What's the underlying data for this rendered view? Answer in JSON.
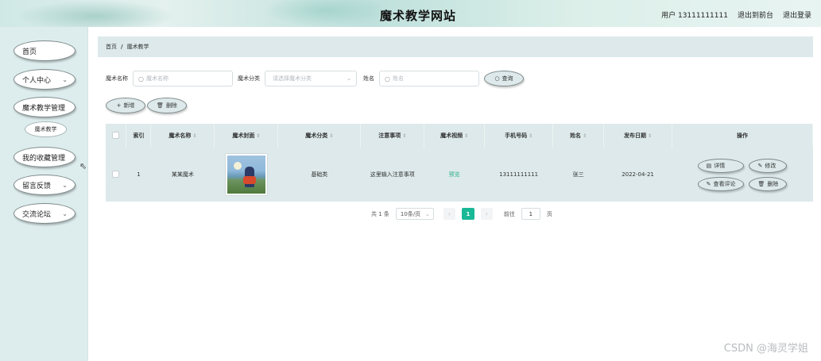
{
  "header": {
    "site_title": "魔术教学网站",
    "user_label": "用户 13111111111",
    "back_to_front": "退出到前台",
    "logout": "退出登录"
  },
  "sidebar": {
    "items": [
      {
        "label": "首页",
        "has_chevron": false
      },
      {
        "label": "个人中心",
        "has_chevron": true
      },
      {
        "label": "魔术教学管理",
        "has_chevron": false
      },
      {
        "label": "我的收藏管理",
        "has_chevron": false
      },
      {
        "label": "留言反馈",
        "has_chevron": true
      },
      {
        "label": "交流论坛",
        "has_chevron": true
      }
    ],
    "sub_item": "魔术教学"
  },
  "breadcrumb": {
    "home": "首页",
    "separator": "/",
    "current": "魔术教学"
  },
  "filters": {
    "name_label": "魔术名称",
    "name_placeholder": "魔术名称",
    "category_label": "魔术分类",
    "category_placeholder": "请选择魔术分类",
    "author_label": "姓名",
    "author_placeholder": "姓名",
    "search_button": "查询"
  },
  "actions": {
    "add": "新增",
    "delete": "删除"
  },
  "table": {
    "headers": [
      "索引",
      "魔术名称",
      "魔术封面",
      "魔术分类",
      "注意事项",
      "魔术视频",
      "手机号码",
      "姓名",
      "发布日期",
      "操作"
    ],
    "rows": [
      {
        "index": "1",
        "name": "某某魔术",
        "category": "基础类",
        "notes": "这里输入注意事项",
        "video": "预览",
        "phone": "13111111111",
        "author": "张三",
        "date": "2022-04-21",
        "ops": {
          "detail": "详情",
          "edit": "修改",
          "comments": "查看评论",
          "delete": "删除"
        }
      }
    ]
  },
  "pagination": {
    "total": "共 1 条",
    "page_size": "10条/页",
    "current_page": "1",
    "goto_label": "前往",
    "goto_value": "1",
    "page_unit": "页"
  },
  "watermark": "CSDN @海灵学姐",
  "colors": {
    "accent": "#19b896",
    "panel": "#dde9ea",
    "sidebar": "#ddeced"
  }
}
